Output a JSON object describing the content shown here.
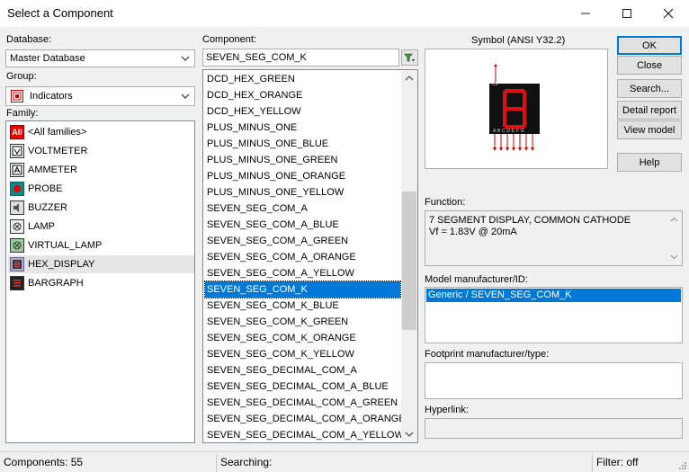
{
  "window": {
    "title": "Select a Component",
    "minimize": "—",
    "maximize": "☐",
    "close": "✕"
  },
  "database": {
    "label": "Database:",
    "value": "Master Database"
  },
  "group": {
    "label": "Group:",
    "value": "Indicators"
  },
  "family": {
    "label": "Family:",
    "items": [
      {
        "label": "<All families>",
        "icon": "all-families-icon"
      },
      {
        "label": "VOLTMETER",
        "icon": "voltmeter-icon"
      },
      {
        "label": "AMMETER",
        "icon": "ammeter-icon"
      },
      {
        "label": "PROBE",
        "icon": "probe-icon"
      },
      {
        "label": "BUZZER",
        "icon": "buzzer-icon"
      },
      {
        "label": "LAMP",
        "icon": "lamp-icon"
      },
      {
        "label": "VIRTUAL_LAMP",
        "icon": "virtual-lamp-icon"
      },
      {
        "label": "HEX_DISPLAY",
        "icon": "hex-display-icon"
      },
      {
        "label": "BARGRAPH",
        "icon": "bargraph-icon"
      }
    ],
    "selected": "HEX_DISPLAY",
    "all_icon_text": "All"
  },
  "component": {
    "label": "Component:",
    "search_value": "SEVEN_SEG_COM_K",
    "items": [
      "DCD_HEX_GREEN",
      "DCD_HEX_ORANGE",
      "DCD_HEX_YELLOW",
      "PLUS_MINUS_ONE",
      "PLUS_MINUS_ONE_BLUE",
      "PLUS_MINUS_ONE_GREEN",
      "PLUS_MINUS_ONE_ORANGE",
      "PLUS_MINUS_ONE_YELLOW",
      "SEVEN_SEG_COM_A",
      "SEVEN_SEG_COM_A_BLUE",
      "SEVEN_SEG_COM_A_GREEN",
      "SEVEN_SEG_COM_A_ORANGE",
      "SEVEN_SEG_COM_A_YELLOW",
      "SEVEN_SEG_COM_K",
      "SEVEN_SEG_COM_K_BLUE",
      "SEVEN_SEG_COM_K_GREEN",
      "SEVEN_SEG_COM_K_ORANGE",
      "SEVEN_SEG_COM_K_YELLOW",
      "SEVEN_SEG_DECIMAL_COM_A",
      "SEVEN_SEG_DECIMAL_COM_A_BLUE",
      "SEVEN_SEG_DECIMAL_COM_A_GREEN",
      "SEVEN_SEG_DECIMAL_COM_A_ORANGE",
      "SEVEN_SEG_DECIMAL_COM_A_YELLOW"
    ],
    "selected": "SEVEN_SEG_COM_K"
  },
  "symbol": {
    "label": "Symbol (ANSI Y32.2)",
    "pin_letters": "A B C D E F G",
    "ck_label": "CK"
  },
  "buttons": {
    "ok": "OK",
    "close": "Close",
    "search": "Search...",
    "detail_report": "Detail report",
    "view_model": "View model",
    "help": "Help"
  },
  "function": {
    "label": "Function:",
    "line1": "7 SEGMENT DISPLAY, COMMON CATHODE",
    "line2": "Vf = 1.83V @ 20mA"
  },
  "model": {
    "label": "Model manufacturer/ID:",
    "value": "Generic / SEVEN_SEG_COM_K"
  },
  "footprint": {
    "label": "Footprint manufacturer/type:",
    "value": ""
  },
  "hyperlink": {
    "label": "Hyperlink:",
    "value": ""
  },
  "status": {
    "components": "Components: 55",
    "searching": "Searching:",
    "filter": "Filter: off"
  },
  "colors": {
    "accent": "#0078d7",
    "segment_red": "#e01010",
    "display_bg": "#111111"
  }
}
